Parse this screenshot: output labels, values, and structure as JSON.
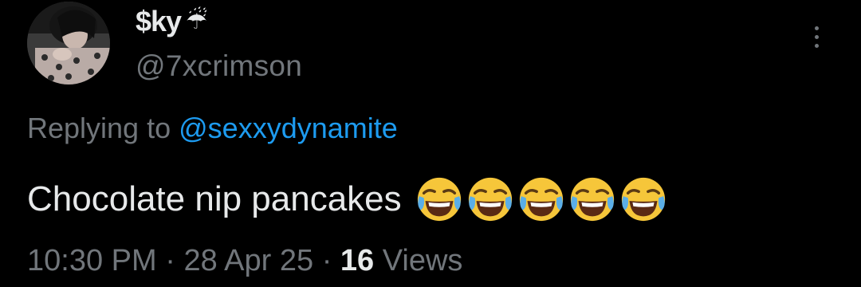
{
  "user": {
    "display_name": "$ky",
    "name_emoji": "☔",
    "handle": "@7xcrimson"
  },
  "reply": {
    "prefix": "Replying to",
    "mention": "@sexxydynamite"
  },
  "tweet": {
    "text": "Chocolate nip pancakes",
    "emojis": [
      "face-with-tears-of-joy",
      "face-with-tears-of-joy",
      "face-with-tears-of-joy",
      "face-with-tears-of-joy",
      "face-with-tears-of-joy"
    ]
  },
  "meta": {
    "time": "10:30 PM",
    "sep1": "·",
    "date": "28 Apr 25",
    "sep2": "·",
    "views_count": "16",
    "views_label": "Views"
  },
  "icons": {
    "more": "more-vertical-icon"
  },
  "colors": {
    "background": "#000000",
    "primary_text": "#e7e9ea",
    "secondary_text": "#71767b",
    "link": "#1d9bf0"
  }
}
